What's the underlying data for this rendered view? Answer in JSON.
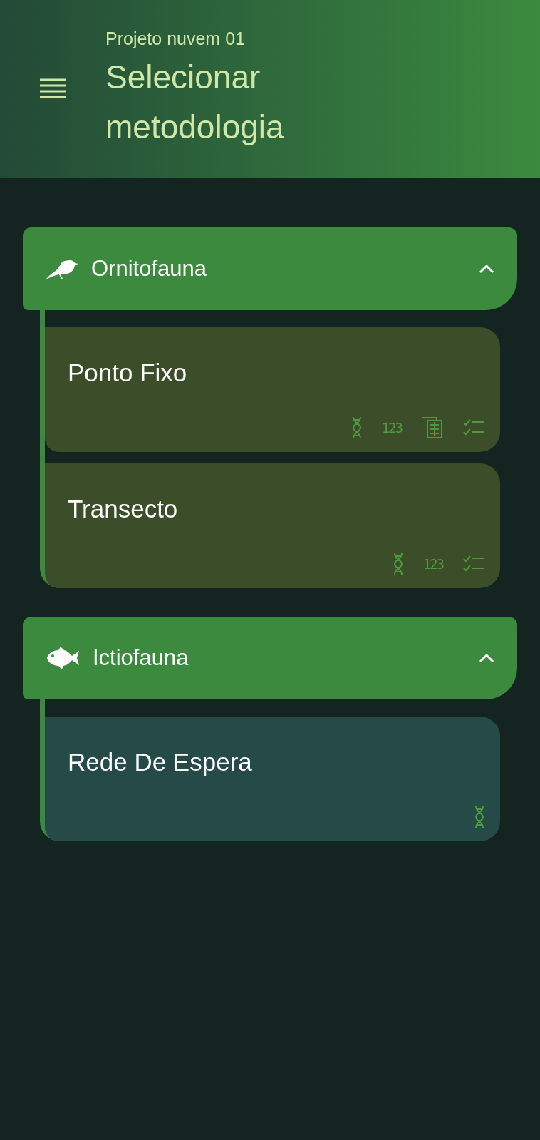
{
  "header": {
    "subtitle": "Projeto nuvem 01",
    "title": "Selecionar metodologia"
  },
  "groups": [
    {
      "name": "Ornitofauna",
      "kind": "bird",
      "expanded": true,
      "methods": [
        {
          "name": "Ponto Fixo",
          "color": "#3b4d29",
          "icons": [
            {
              "kind": "dna"
            },
            {
              "kind": "numbers",
              "text": "123"
            },
            {
              "kind": "table"
            },
            {
              "kind": "checklist"
            }
          ]
        },
        {
          "name": "Transecto",
          "color": "#3b4d29",
          "icons": [
            {
              "kind": "dna"
            },
            {
              "kind": "numbers",
              "text": "123"
            },
            {
              "kind": "checklist"
            }
          ]
        }
      ]
    },
    {
      "name": "Ictiofauna",
      "kind": "fish",
      "expanded": true,
      "methods": [
        {
          "name": "Rede De Espera",
          "color": "#254a48",
          "icons": [
            {
              "kind": "dna"
            }
          ]
        }
      ]
    }
  ]
}
